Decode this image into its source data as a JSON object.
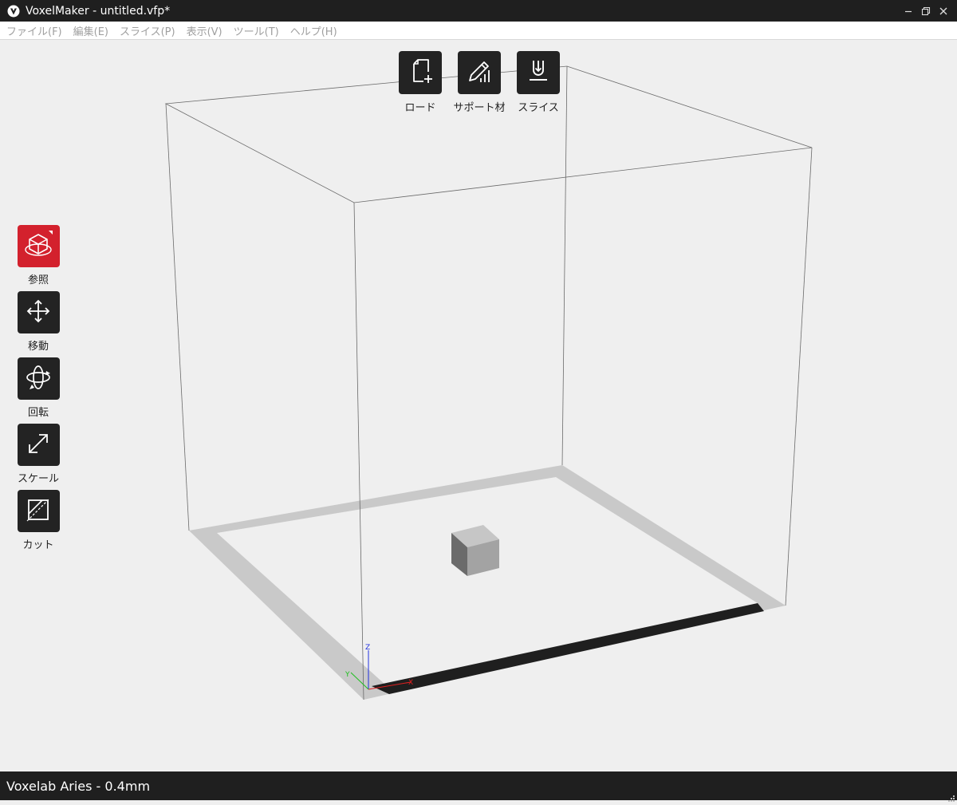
{
  "window": {
    "title": "VoxelMaker - untitled.vfp*",
    "controls": [
      "minimize-icon",
      "restore-icon",
      "close-icon"
    ]
  },
  "menu": [
    {
      "label": "ファイル(F)"
    },
    {
      "label": "編集(E)"
    },
    {
      "label": "スライス(P)"
    },
    {
      "label": "表示(V)"
    },
    {
      "label": "ツール(T)"
    },
    {
      "label": "ヘルプ(H)"
    }
  ],
  "top_toolbar": [
    {
      "label": "ロード",
      "icon": "load-file-icon"
    },
    {
      "label": "サポート材",
      "icon": "support-pencil-icon"
    },
    {
      "label": "スライス",
      "icon": "slice-download-icon"
    }
  ],
  "left_toolbar": [
    {
      "label": "参照",
      "icon": "view-cube-icon",
      "active": true
    },
    {
      "label": "移動",
      "icon": "move-arrows-icon",
      "active": false
    },
    {
      "label": "回転",
      "icon": "rotate-icon",
      "active": false
    },
    {
      "label": "スケール",
      "icon": "scale-arrows-icon",
      "active": false
    },
    {
      "label": "カット",
      "icon": "cut-icon",
      "active": false
    }
  ],
  "scene": {
    "axes": {
      "x": "X",
      "y": "Y",
      "z": "Z"
    },
    "axis_colors": {
      "x": "#e02020",
      "y": "#20c020",
      "z": "#2030e0"
    }
  },
  "status": {
    "printer": "Voxelab Aries - 0.4mm"
  },
  "colors": {
    "titlebar": "#1f1f1f",
    "accent": "#d3212d",
    "button": "#232323",
    "background": "#efefef"
  }
}
